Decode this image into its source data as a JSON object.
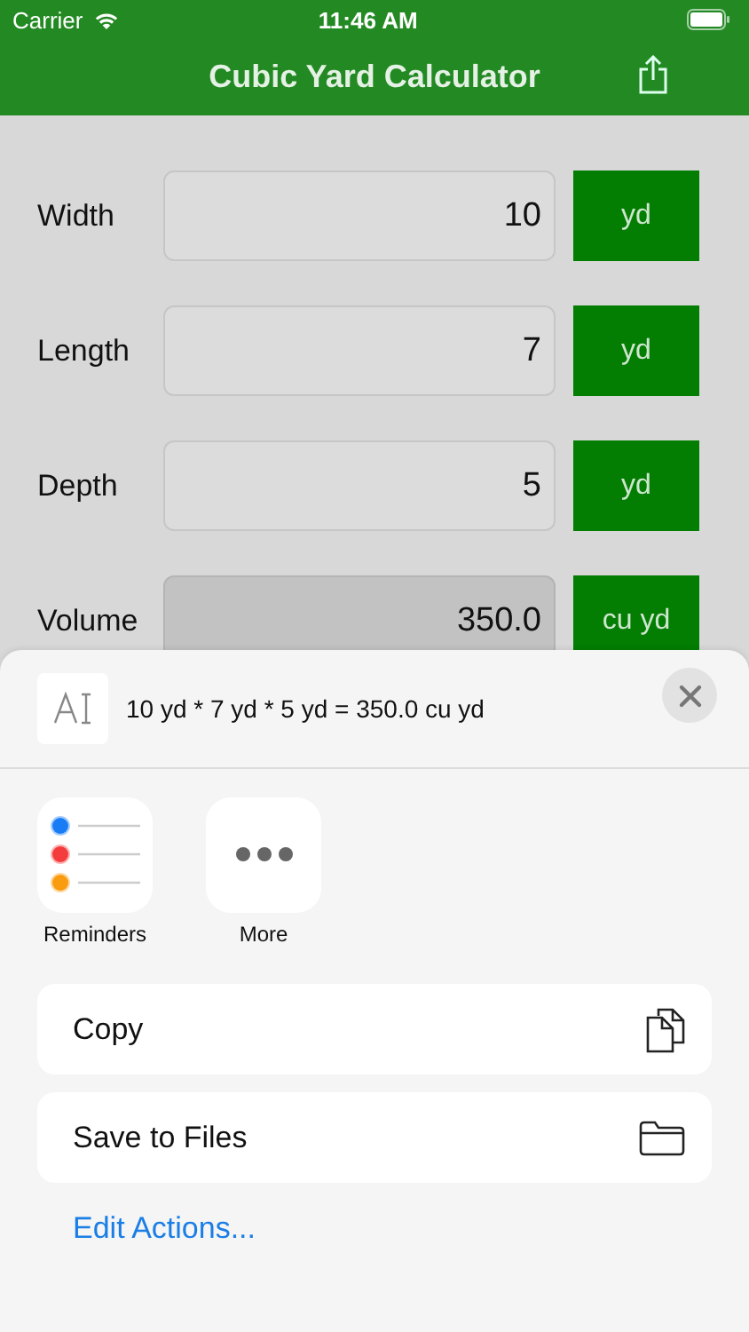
{
  "status_bar": {
    "carrier": "Carrier",
    "time": "11:46 AM"
  },
  "nav": {
    "title": "Cubic Yard Calculator"
  },
  "rows": [
    {
      "label": "Width",
      "value": "10",
      "unit": "yd",
      "readonly": false
    },
    {
      "label": "Length",
      "value": "7",
      "unit": "yd",
      "readonly": false
    },
    {
      "label": "Depth",
      "value": "5",
      "unit": "yd",
      "readonly": false
    },
    {
      "label": "Volume",
      "value": "350.0",
      "unit": "cu yd",
      "readonly": true
    }
  ],
  "share_sheet": {
    "preview_text": "10 yd * 7 yd * 5 yd = 350.0 cu yd",
    "apps": [
      {
        "label": "Reminders",
        "kind": "reminders"
      },
      {
        "label": "More",
        "kind": "more"
      }
    ],
    "actions": [
      {
        "label": "Copy",
        "kind": "copy"
      },
      {
        "label": "Save to Files",
        "kind": "folder"
      }
    ],
    "edit_actions": "Edit Actions..."
  }
}
